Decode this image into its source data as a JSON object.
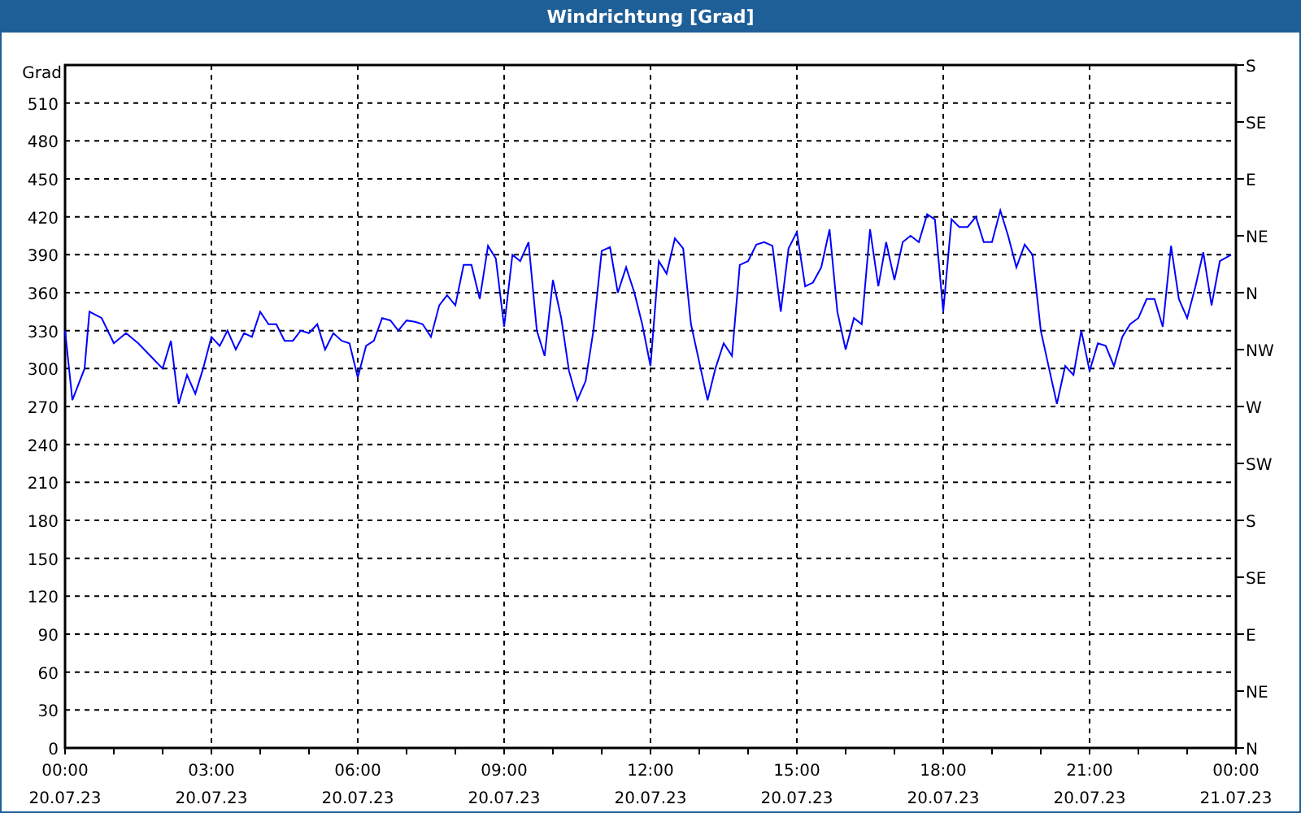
{
  "window": {
    "title": "Windrichtung [Grad]"
  },
  "chart": {
    "chart_data": {
      "type": "line",
      "grid": true,
      "ylabel": "Grad",
      "xlim": [
        0,
        24
      ],
      "ylim": [
        0,
        540
      ],
      "yticks": [
        0,
        30,
        60,
        90,
        120,
        150,
        180,
        210,
        240,
        270,
        300,
        330,
        360,
        390,
        420,
        450,
        480,
        510
      ],
      "xticks": [
        {
          "value": 0,
          "label": "00:00"
        },
        {
          "value": 3,
          "label": "03:00"
        },
        {
          "value": 6,
          "label": "06:00"
        },
        {
          "value": 9,
          "label": "09:00"
        },
        {
          "value": 12,
          "label": "12:00"
        },
        {
          "value": 15,
          "label": "15:00"
        },
        {
          "value": 18,
          "label": "18:00"
        },
        {
          "value": 21,
          "label": "21:00"
        },
        {
          "value": 24,
          "label": "00:00"
        }
      ],
      "x": [
        0,
        0.15,
        0.4,
        0.5,
        0.75,
        1,
        1.25,
        1.5,
        1.75,
        2,
        2.17,
        2.33,
        2.5,
        2.67,
        2.83,
        3,
        3.17,
        3.33,
        3.5,
        3.67,
        3.83,
        4,
        4.17,
        4.33,
        4.5,
        4.67,
        4.83,
        5,
        5.17,
        5.33,
        5.5,
        5.67,
        5.83,
        6,
        6.17,
        6.33,
        6.5,
        6.67,
        6.83,
        7,
        7.17,
        7.33,
        7.5,
        7.67,
        7.83,
        8,
        8.17,
        8.33,
        8.5,
        8.67,
        8.83,
        9,
        9.17,
        9.33,
        9.5,
        9.67,
        9.83,
        10,
        10.17,
        10.33,
        10.5,
        10.67,
        10.83,
        11,
        11.17,
        11.33,
        11.5,
        11.67,
        11.83,
        12,
        12.17,
        12.33,
        12.5,
        12.67,
        12.83,
        13,
        13.17,
        13.33,
        13.5,
        13.67,
        13.83,
        14,
        14.17,
        14.33,
        14.5,
        14.67,
        14.83,
        15,
        15.17,
        15.33,
        15.5,
        15.67,
        15.83,
        16,
        16.17,
        16.33,
        16.5,
        16.67,
        16.83,
        17,
        17.17,
        17.33,
        17.5,
        17.67,
        17.83,
        18,
        18.17,
        18.33,
        18.5,
        18.67,
        18.83,
        19,
        19.17,
        19.33,
        19.5,
        19.67,
        19.83,
        20,
        20.17,
        20.33,
        20.5,
        20.67,
        20.83,
        21,
        21.17,
        21.33,
        21.5,
        21.67,
        21.83,
        22,
        22.17,
        22.33,
        22.5,
        22.67,
        22.83,
        23,
        23.17,
        23.33,
        23.5,
        23.67,
        23.9
      ],
      "series": [
        {
          "color": "#0000ff",
          "values": [
            330,
            275,
            300,
            345,
            340,
            320,
            328,
            320,
            310,
            300,
            322,
            272,
            295,
            280,
            300,
            325,
            318,
            330,
            315,
            328,
            325,
            345,
            335,
            335,
            322,
            322,
            330,
            328,
            335,
            315,
            328,
            322,
            320,
            293,
            318,
            322,
            340,
            338,
            330,
            338,
            337,
            335,
            325,
            350,
            358,
            350,
            382,
            382,
            355,
            397,
            387,
            333,
            390,
            385,
            400,
            330,
            310,
            370,
            340,
            298,
            275,
            290,
            330,
            393,
            396,
            360,
            380,
            360,
            335,
            302,
            385,
            375,
            403,
            395,
            335,
            305,
            275,
            300,
            320,
            310,
            382,
            385,
            398,
            400,
            397,
            345,
            395,
            408,
            365,
            368,
            380,
            410,
            345,
            315,
            340,
            335,
            410,
            365,
            400,
            370,
            400,
            405,
            400,
            422,
            418,
            345,
            418,
            412,
            412,
            420,
            400,
            400,
            425,
            405,
            380,
            398,
            390,
            330,
            300,
            272,
            302,
            295,
            330,
            298,
            320,
            318,
            302,
            325,
            335,
            340,
            355,
            355,
            333,
            397,
            355,
            340,
            365,
            392,
            350,
            385,
            390
          ]
        }
      ]
    },
    "xtick_dates": [
      "20.07.23",
      "20.07.23",
      "20.07.23",
      "20.07.23",
      "20.07.23",
      "20.07.23",
      "20.07.23",
      "20.07.23",
      "21.07.23"
    ],
    "right_axis": [
      "S",
      "SE",
      "E",
      "NE",
      "N",
      "NW",
      "W",
      "SW",
      "S",
      "SE",
      "E",
      "NE",
      "N"
    ]
  }
}
